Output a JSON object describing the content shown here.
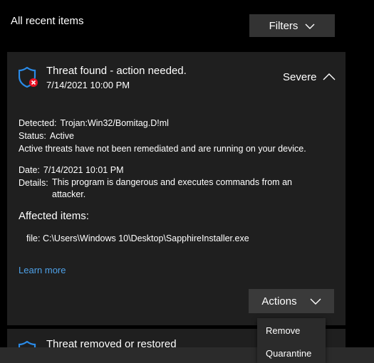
{
  "header": {
    "title": "All recent items",
    "filters_label": "Filters"
  },
  "threat": {
    "title": "Threat found - action needed.",
    "date": "7/14/2021 10:00 PM",
    "severity": "Severe",
    "detected_label": "Detected:",
    "detected_value": "Trojan:Win32/Bomitag.D!ml",
    "status_label": "Status:",
    "status_value": "Active",
    "status_message": "Active threats have not been remediated and are running on your device.",
    "date_label": "Date:",
    "date_value": "7/14/2021 10:01 PM",
    "details_label": "Details:",
    "details_value": "This program is dangerous and executes commands from an attacker.",
    "affected_heading": "Affected items:",
    "file_label": "file:",
    "file_path": "C:\\Users\\Windows 10\\Desktop\\SapphireInstaller.exe",
    "learn_more": "Learn more",
    "actions_label": "Actions"
  },
  "next_item": {
    "title": "Threat removed or restored"
  },
  "actions_menu": {
    "items": [
      "Remove",
      "Quarantine"
    ]
  },
  "colors": {
    "background": "#000000",
    "card": "#1f1f1f",
    "button": "#333333",
    "link": "#4ea1e8",
    "shield": "#2a8be8",
    "badge": "#e81123"
  },
  "icons": {
    "shield": "shield-icon",
    "badge": "error-badge-icon",
    "chevron_up": "chevron-up-icon",
    "chevron_down": "chevron-down-icon"
  }
}
